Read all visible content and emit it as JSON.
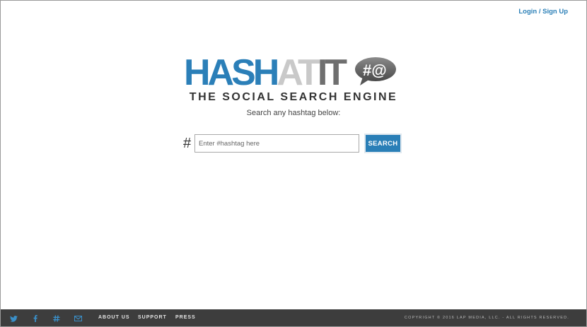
{
  "header": {
    "login_label": "Login / Sign Up"
  },
  "logo": {
    "part1": "HASH",
    "part2": "AT",
    "part3": "IT",
    "bubble_text": "#@"
  },
  "tagline": "THE SOCIAL SEARCH ENGINE",
  "subtitle": "Search any hashtag below:",
  "search": {
    "prefix": "#",
    "placeholder": "Enter #hashtag here",
    "value": "",
    "button_label": "SEARCH"
  },
  "footer": {
    "social_icons": [
      "twitter-icon",
      "facebook-icon",
      "hashtag-icon",
      "email-icon"
    ],
    "links": [
      "ABOUT US",
      "SUPPORT",
      "PRESS"
    ],
    "copyright": "COPYRIGHT © 2016 LAP MEDIA, LLC. - ALL RIGHTS RESERVED."
  },
  "colors": {
    "brand_blue": "#2b7fb8",
    "footer_bg": "#3d3d3d",
    "logo_grey_light": "#c9c9c9",
    "logo_grey_dark": "#6f6f6f"
  }
}
